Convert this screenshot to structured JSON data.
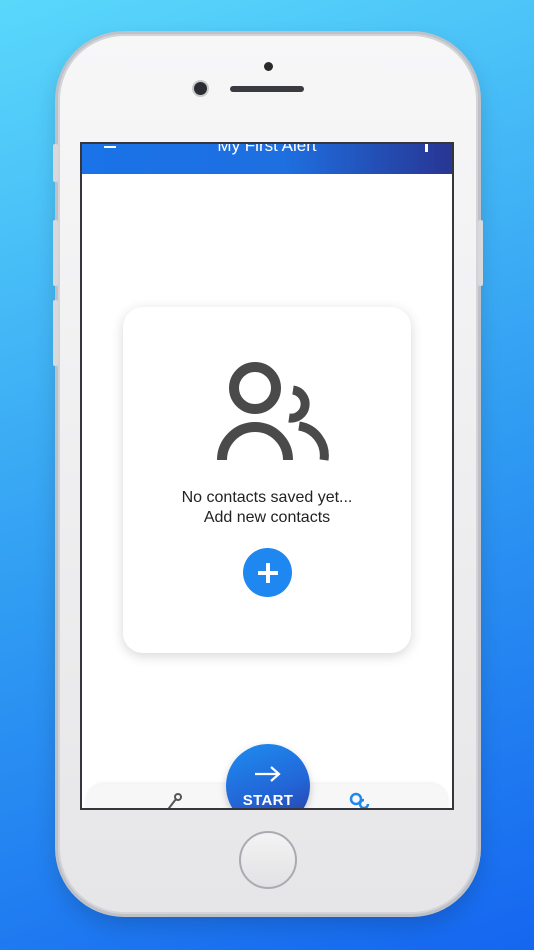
{
  "appbar": {
    "title": "My First Alert",
    "menu_icon": "menu-icon",
    "more_icon": "more-vert-icon",
    "gradient": [
      "#1a73e8",
      "#283593"
    ]
  },
  "empty_state": {
    "icon": "people-icon",
    "line1": "No contacts saved yet...",
    "line2": "Add new contacts",
    "add_icon": "plus-icon",
    "accent": "#1e88f0"
  },
  "bottom_nav": {
    "left_icon": "route-icon",
    "right_icon": "contacts-icon",
    "start_label": "START",
    "start_icon": "arrow-right-icon"
  }
}
